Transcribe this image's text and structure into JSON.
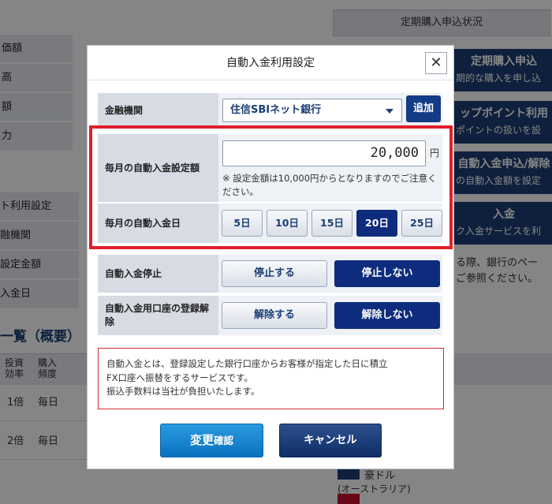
{
  "background": {
    "left_rows": [
      "価額",
      "高",
      "額",
      "力"
    ],
    "left_rows2": [
      "ト利用設定",
      "融機関",
      "設定金額",
      "入金日"
    ],
    "status_tab": "定期購入申込状況",
    "nav_blocks": [
      {
        "title": "定期購入申込",
        "sub": "期的な購入を申し込"
      },
      {
        "title": "ップポイント利用",
        "sub": "ポイントの扱いを設"
      },
      {
        "title": "自動入金申込/解除",
        "sub": "の自動入金額を設定"
      },
      {
        "title": "入金",
        "sub": "ク入金サービスを利"
      }
    ],
    "side_text": [
      "る際、銀行のペー",
      "ご参照ください。"
    ],
    "section_heading": "一覧（概要）",
    "table_head": [
      "投資効率",
      "購入頻度"
    ],
    "table_rows": [
      {
        "ratio": "1倍",
        "freq": "毎日"
      },
      {
        "ratio": "2倍",
        "freq": "毎日"
      }
    ],
    "currency_name": "豪ドル",
    "currency_sub": "(オーストラリア)"
  },
  "modal": {
    "title": "自動入金利用設定",
    "close_label": "✕",
    "bank": {
      "label": "金融機関",
      "value": "住信SBIネット銀行",
      "add_label": "追加"
    },
    "amount": {
      "label": "毎月の自動入金設定額",
      "value": "20,000",
      "unit": "円",
      "note": "※ 設定金額は10,000円からとなりますのでご注意ください。"
    },
    "day": {
      "label": "毎月の自動入金日",
      "options": [
        "5日",
        "10日",
        "15日",
        "20日",
        "25日"
      ],
      "selected": "20日"
    },
    "stop": {
      "label": "自動入金停止",
      "options": [
        "停止する",
        "停止しない"
      ],
      "selected": "停止しない"
    },
    "unregister": {
      "label": "自動入金用口座の登録解除",
      "options": [
        "解除する",
        "解除しない"
      ],
      "selected": "解除しない"
    },
    "info": [
      "自動入金とは、登録設定した銀行口座からお客様が指定した日に積立",
      "FX口座へ振替をするサービスです。",
      "振込手数料は当社が負担いたします。"
    ],
    "confirm_main": "変更",
    "confirm_small": "確認",
    "cancel_label": "キャンセル"
  }
}
